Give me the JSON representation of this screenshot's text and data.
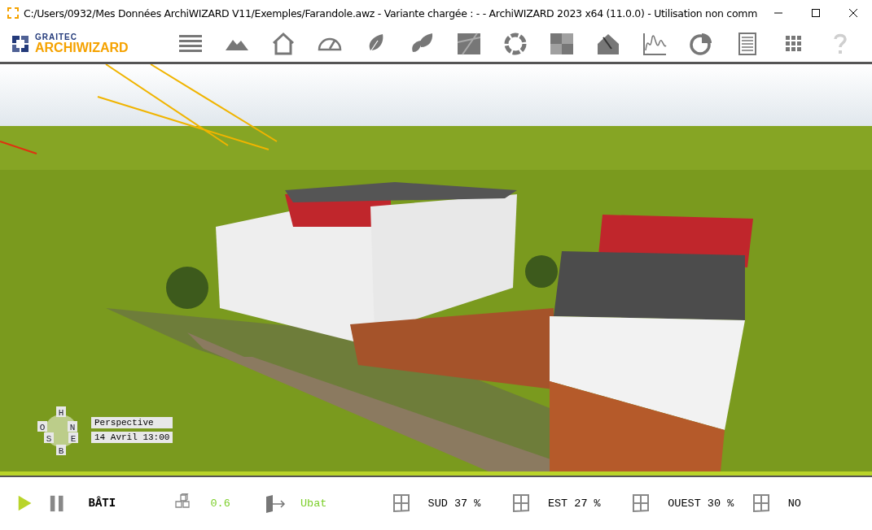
{
  "window": {
    "title": "C:/Users/0932/Mes Données ArchiWIZARD V11/Exemples/Farandole.awz - Variante chargée : -   -  ArchiWIZARD 2023 x64 (11.0.0) - Utilisation non comm"
  },
  "logo": {
    "brand": "GRAITEC",
    "product": "ARCHIWIZARD"
  },
  "toolbar": [
    {
      "kind": "menu",
      "disabled": false
    },
    {
      "kind": "mountains",
      "disabled": false
    },
    {
      "kind": "house",
      "disabled": false
    },
    {
      "kind": "gauge",
      "disabled": false
    },
    {
      "kind": "leaf",
      "disabled": false
    },
    {
      "kind": "leaves",
      "disabled": false
    },
    {
      "kind": "texture",
      "disabled": false
    },
    {
      "kind": "ring",
      "disabled": false
    },
    {
      "kind": "tiles",
      "disabled": false
    },
    {
      "kind": "house-tool",
      "disabled": false
    },
    {
      "kind": "graph",
      "disabled": false
    },
    {
      "kind": "pie",
      "disabled": false
    },
    {
      "kind": "document",
      "disabled": false
    },
    {
      "kind": "grid",
      "disabled": false
    },
    {
      "kind": "help",
      "disabled": true
    }
  ],
  "viewport": {
    "kind": "picture",
    "compass": [
      "H",
      "O",
      "N",
      "S",
      "E",
      "B"
    ],
    "view_label": "Perspective",
    "date_label": "14 Avril 13:00"
  },
  "status_bar": {
    "playback": [
      {
        "kind": "play"
      },
      {
        "kind": "pause"
      }
    ],
    "mode": "BÂTI",
    "items": [
      {
        "kind": "cubes",
        "value": "0.6"
      },
      {
        "kind": "door",
        "value": "Ubat"
      },
      {
        "kind": "window",
        "value": "SUD 37 %"
      },
      {
        "kind": "window",
        "value": "EST 27 %"
      },
      {
        "kind": "window",
        "value": "OUEST 30 %"
      },
      {
        "kind": "window",
        "value": "NO"
      }
    ]
  }
}
